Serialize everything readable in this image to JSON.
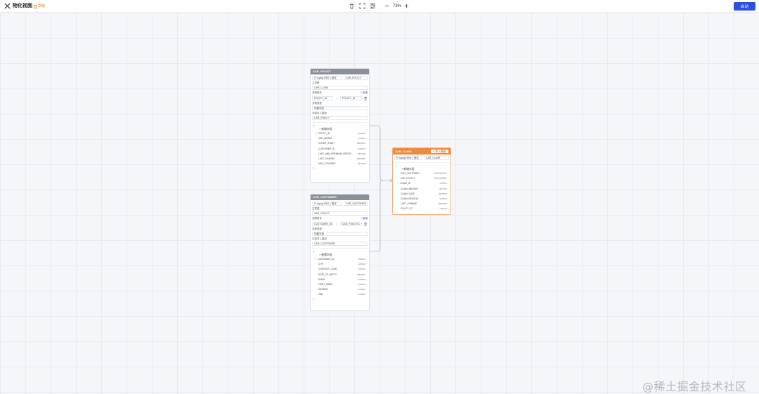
{
  "header": {
    "title": "物化视图",
    "draft_label": "草稿",
    "zoom": "73%",
    "start_label": "启动"
  },
  "nodes": {
    "car_policy": {
      "title": "CAR_POLICY",
      "source_db": "mysql-0901 | 测试",
      "source_table": "CAR_POLICY",
      "main_table_label": "主表是",
      "main_table": "CAR_CLAIM",
      "join_cond_label": "关联条件",
      "add_label": "+ 新增",
      "join_left": "POLICY_ID",
      "join_op": "=",
      "join_right": "POLICY_ID",
      "join_type_label": "关联类型",
      "join_type": "内嵌字段",
      "write_path_label": "字段写入路径",
      "write_path": "CAR_POLICY",
      "new_field_label": "+ 新增字段",
      "brace_open": "{",
      "brace_close": "}",
      "fields": [
        {
          "name": "POLICY_ID",
          "type": "varchar",
          "key": true
        },
        {
          "name": "CAR_MODEL",
          "type": "varchar",
          "key": false
        },
        {
          "name": "COVER_START",
          "type": "datetime",
          "key": false
        },
        {
          "name": "CUSTOMER_ID",
          "type": "varchar",
          "key": false
        },
        {
          "name": "LAST_ANN_PREMIUM_GROSS",
          "type": "decimal",
          "key": false
        },
        {
          "name": "LAST_CHANGE",
          "type": "datetime",
          "key": false
        },
        {
          "name": "MAX_COVERED",
          "type": "decimal",
          "key": false
        }
      ]
    },
    "car_customer": {
      "title": "CAR_CUSTOMER",
      "source_db": "mysql-0901 | 测试",
      "source_table": "CAR_CUSTOMER",
      "main_table_label": "主表是",
      "main_table": "CAR_POLICY",
      "join_cond_label": "关联条件",
      "add_label": "+ 新增",
      "join_left": "CUSTOMER_ID",
      "join_op": "=",
      "join_right": "CAR_POLICY.C",
      "join_type_label": "关联类型",
      "join_type": "内嵌字段",
      "write_path_label": "字段写入路径",
      "write_path": "CAR_CUSTOMER",
      "new_field_label": "+ 新增字段",
      "brace_open": "{",
      "brace_close": "}",
      "fields": [
        {
          "name": "CUSTOMER_ID",
          "type": "varchar",
          "key": true
        },
        {
          "name": "CITY",
          "type": "varchar",
          "key": false
        },
        {
          "name": "COUNTRY_CODE",
          "type": "varchar",
          "key": false
        },
        {
          "name": "DATE_OF_BIRTH",
          "type": "datetime",
          "key": false
        },
        {
          "name": "EMAIL",
          "type": "varchar",
          "key": false
        },
        {
          "name": "FIRST_NAME",
          "type": "varchar",
          "key": false
        },
        {
          "name": "GENDER",
          "type": "varchar",
          "key": false
        },
        {
          "name": "JOB",
          "type": "varchar",
          "key": false
        }
      ]
    },
    "car_claim": {
      "title": "CAR_CLAIM",
      "import_label": "+ 导入模板",
      "source_db": "mysql-0901 | 测试",
      "source_table": "CAR_CLAIM",
      "new_field_label": "+ 新增字段",
      "brace_open": "{",
      "brace_close": "}",
      "fields": [
        {
          "name": "CAR_CUSTOMER",
          "type": "DOCUMENT",
          "key": false
        },
        {
          "name": "CAR_POLICY",
          "type": "DOCUMENT",
          "key": false
        },
        {
          "name": "CLAIM_ID",
          "type": "varchar",
          "key": true
        },
        {
          "name": "CLAIM_AMOUNT",
          "type": "decimal",
          "key": false
        },
        {
          "name": "CLAIM_DATE",
          "type": "datetime",
          "key": false
        },
        {
          "name": "CLAIM_REASON",
          "type": "varchar",
          "key": false
        },
        {
          "name": "LAST_CHANGE",
          "type": "datetime",
          "key": false
        },
        {
          "name": "POLICY_ID",
          "type": "varchar",
          "key": false
        }
      ]
    }
  },
  "watermark": "@稀土掘金技术社区",
  "colors": {
    "accent": "#2f4fe0",
    "node_header": "#8a8f98",
    "target_header": "#f0893b",
    "draft": "#e8842e"
  }
}
